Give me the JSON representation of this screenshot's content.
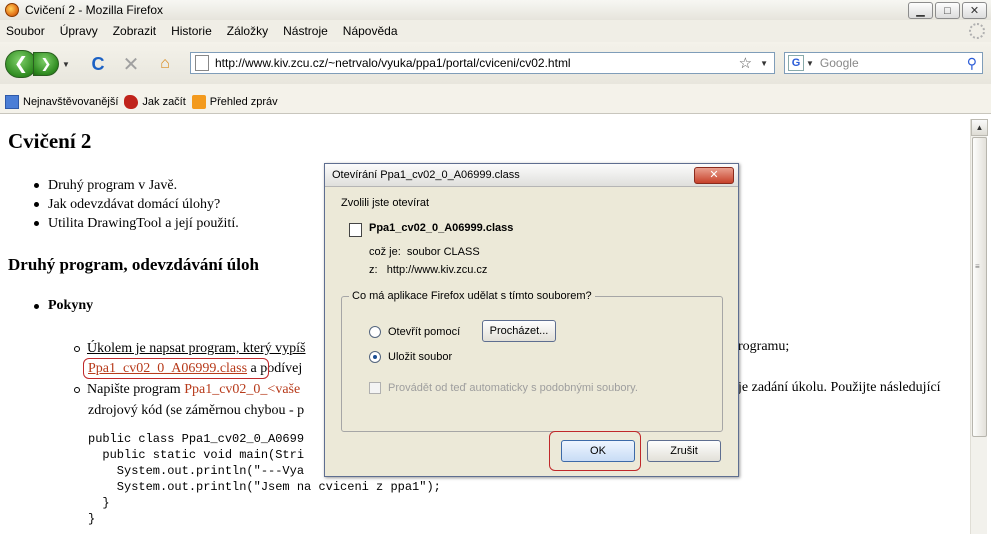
{
  "window": {
    "title": "Cvičení 2 - Mozilla Firefox",
    "minimize": "▁",
    "maximize": "□",
    "close": "✕"
  },
  "menu": {
    "items": [
      "Soubor",
      "Úpravy",
      "Zobrazit",
      "Historie",
      "Záložky",
      "Nástroje",
      "Nápověda"
    ]
  },
  "nav": {
    "back": "❮",
    "forward": "❯",
    "reload": "C",
    "stop": "✕",
    "home": "⌂",
    "url": "http://www.kiv.zcu.cz/~netrvalo/vyuka/ppa1/portal/cviceni/cv02.html",
    "star": "☆",
    "search_engine": "G",
    "search_placeholder": "Google",
    "search_icon": "⚲"
  },
  "bookmarks": {
    "items": [
      "Nejnavštěvovanější",
      "Jak začít",
      "Přehled zpráv"
    ]
  },
  "page": {
    "title": "Cvičení 2",
    "intro_list": [
      "Druhý program v Javě.",
      "Jak odevzdávat domácí úlohy?",
      "Utilita DrawingTool a její použití."
    ],
    "section_title": "Druhý program, odevzdávání úloh",
    "pokyny": "Pokyny",
    "item1_line1": "Úkolem je napsat program, který vypíš",
    "item1_right": "rogramu;",
    "item1_link": "Ppa1_cv02_0_A06999.class",
    "item1_after_link": " a podívej",
    "item2_prefix": "Napište program ",
    "item2_link": "Ppa1_cv02_0_<vaše",
    "item2_right": "je zadání úkolu. Použijte následující",
    "item2_line2": "zdrojový kód (se záměrnou chybou - p",
    "code_lines": [
      "public class Ppa1_cv02_0_A0699",
      "  public static void main(Stri",
      "    System.out.println(\"---Vya",
      "    System.out.println(\"Jsem na cviceni z ppa1\");",
      "  }",
      "}"
    ]
  },
  "dialog": {
    "title": "Otevírání Ppa1_cv02_0_A06999.class",
    "close": "✕",
    "chosen_label": "Zvolili jste otevírat",
    "filename": "Ppa1_cv02_0_A06999.class",
    "type_label": "což je:",
    "type_value": "soubor CLASS",
    "from_label": "z:",
    "from_value": "http://www.kiv.zcu.cz",
    "group_legend": "Co má aplikace Firefox udělat s tímto souborem?",
    "open_with_label": "Otevřít pomocí",
    "browse_button": "Procházet...",
    "save_label": "Uložit soubor",
    "auto_label": "Provádět od teď automaticky s podobnými soubory.",
    "ok_button": "OK",
    "cancel_button": "Zrušit"
  }
}
